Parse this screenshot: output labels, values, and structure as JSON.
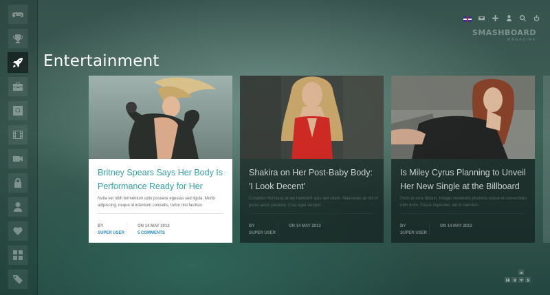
{
  "page": {
    "title": "Entertainment"
  },
  "brand": {
    "name": "SMASHBOARD",
    "sub": "MAGAZINE"
  },
  "sidebar": {
    "items": [
      {
        "icon": "gamepad-icon"
      },
      {
        "icon": "trophy-icon"
      },
      {
        "icon": "rocket-icon",
        "active": true
      },
      {
        "icon": "briefcase-icon"
      },
      {
        "icon": "github-icon"
      },
      {
        "icon": "film-icon"
      },
      {
        "icon": "video-camera-icon"
      },
      {
        "icon": "lock-icon"
      },
      {
        "icon": "user-icon"
      },
      {
        "icon": "heart-icon"
      },
      {
        "icon": "grid-icon"
      },
      {
        "icon": "tags-icon"
      }
    ]
  },
  "topbar": {
    "icons": [
      "uk-flag-icon",
      "mail-icon",
      "plus-icon",
      "user-icon",
      "search-icon",
      "power-icon"
    ]
  },
  "cards": [
    {
      "title": "Britney Spears Says Her Body Is Performance Ready for Her",
      "excerpt": "Nulla vel nibh fermentum odio posuere egestas sed ligula. Morbi adipiscing, neque id interdum convallis, tortor nisi facilisis",
      "by_label": "BY",
      "author": "SUPER USER",
      "date": "ON 14 MAY 2013",
      "comments": "5 COMMENTS"
    },
    {
      "title": "Shakira on Her Post-Baby Body: 'I Look Decent'",
      "excerpt": "Curabitur nisl lacus at leo hendrerit quis sed ullam. Maecenas ac dui in purus lacus placerat. Cras eget semper",
      "by_label": "BY",
      "author": "SUPER USER",
      "date": "ON 14 MAY 2013"
    },
    {
      "title": "Is Miley Cyrus Planning to Unveil Her New Single at the Billboard",
      "excerpt": "Proin et eros dictum. Integer venenatis pharetra neque et consectetur nibh dolor. Fusce imperdiet, elit id interdum",
      "by_label": "BY",
      "author": "SUPER USER",
      "date": "ON 14 MAY 2013"
    }
  ],
  "colors": {
    "accent": "#33a0a8",
    "link": "#2a8fc5"
  }
}
